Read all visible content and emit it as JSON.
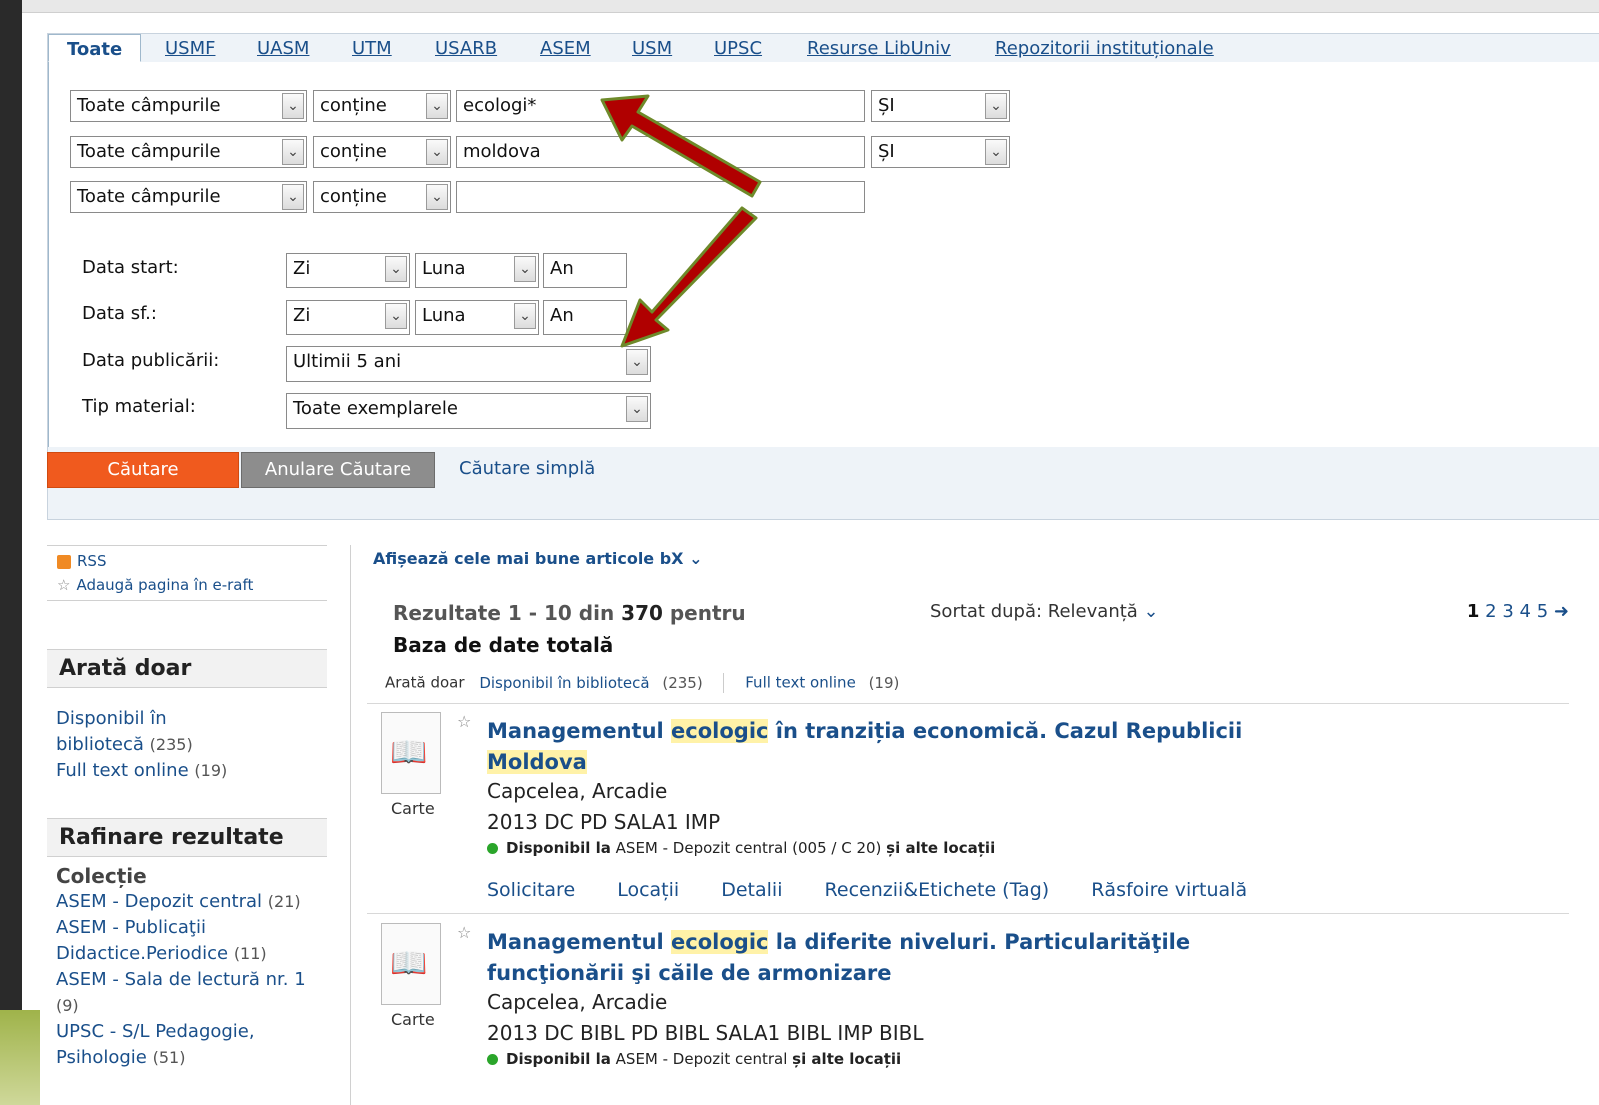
{
  "tabs": [
    "Toate",
    "USMF",
    "UASM",
    "UTM",
    "USARB",
    "ASEM",
    "USM",
    "UPSC",
    "Resurse LibUniv",
    "Repozitorii instituționale"
  ],
  "search_rows": [
    {
      "field": "Toate câmpurile",
      "op": "conține",
      "value": "ecologi*",
      "bool": "ȘI"
    },
    {
      "field": "Toate câmpurile",
      "op": "conține",
      "value": "moldova",
      "bool": "ȘI"
    },
    {
      "field": "Toate câmpurile",
      "op": "conține",
      "value": "",
      "bool": ""
    }
  ],
  "dates": {
    "start_label": "Data start:",
    "end_label": "Data sf.:",
    "day": "Zi",
    "month": "Luna",
    "year": "An",
    "pub_label": "Data publicării:",
    "pub_value": "Ultimii 5 ani",
    "type_label": "Tip material:",
    "type_value": "Toate exemplarele"
  },
  "buttons": {
    "search": "Căutare",
    "cancel": "Anulare Căutare",
    "simple": "Căutare simplă"
  },
  "sidebar": {
    "rss": "RSS",
    "shelf": "Adaugă pagina în e-raft",
    "show_only": "Arată doar",
    "show_items": [
      {
        "label": "Disponibil în bibliotecă",
        "count": "(235)"
      },
      {
        "label": "Full text online",
        "count": "(19)"
      }
    ],
    "refine": "Rafinare rezultate",
    "collection": "Colecție",
    "collections": [
      {
        "label": "ASEM - Depozit central",
        "count": "(21)"
      },
      {
        "label": "ASEM - Publicaţii Didactice.Periodice",
        "count": "(11)"
      },
      {
        "label": "ASEM - Sala de lectură nr. 1",
        "count": "(9)"
      },
      {
        "label": "UPSC - S/L Pedagogie, Psihologie",
        "count": "(51)"
      }
    ]
  },
  "results": {
    "bx": "Afișează cele mai bune articole bX",
    "title_prefix": "Rezultate 1 - 10 din ",
    "total": "370",
    "title_suffix": " pentru",
    "db": "Baza de date totală",
    "sorted": "Sortat după: Relevanță",
    "pages": [
      "1",
      "2",
      "3",
      "4",
      "5"
    ],
    "filter_label": "Arată doar",
    "filter_avail": "Disponibil în bibliotecă",
    "filter_avail_count": "(235)",
    "filter_full": "Full text online",
    "filter_full_count": "(19)",
    "records": [
      {
        "type": "Carte",
        "title_a": "Managementul ",
        "title_hl": "ecologic",
        "title_b": " în tranziția economică. Cazul Republicii ",
        "title_hl2": "Moldova",
        "author": "Capcelea, Arcadie",
        "call": "2013 DC PD SALA1 IMP",
        "avail_a": "Disponibil la",
        "avail_b": " ASEM - Depozit central  (005 / C 20) ",
        "avail_c": "și alte locații",
        "actions": [
          "Solicitare",
          "Locații",
          "Detalii",
          "Recenzii&Etichete (Tag)",
          "Răsfoire virtuală"
        ]
      },
      {
        "type": "Carte",
        "title_a": "Managementul ",
        "title_hl": "ecologic",
        "title_b": " la diferite niveluri. Particularităţile funcţionării şi căile de armonizare",
        "author": "Capcelea, Arcadie",
        "call": "2013 DC BIBL PD BIBL SALA1 BIBL IMP BIBL",
        "avail_a": "Disponibil la",
        "avail_b": " ASEM - Depozit central  ",
        "avail_c": "și alte locații"
      }
    ]
  }
}
